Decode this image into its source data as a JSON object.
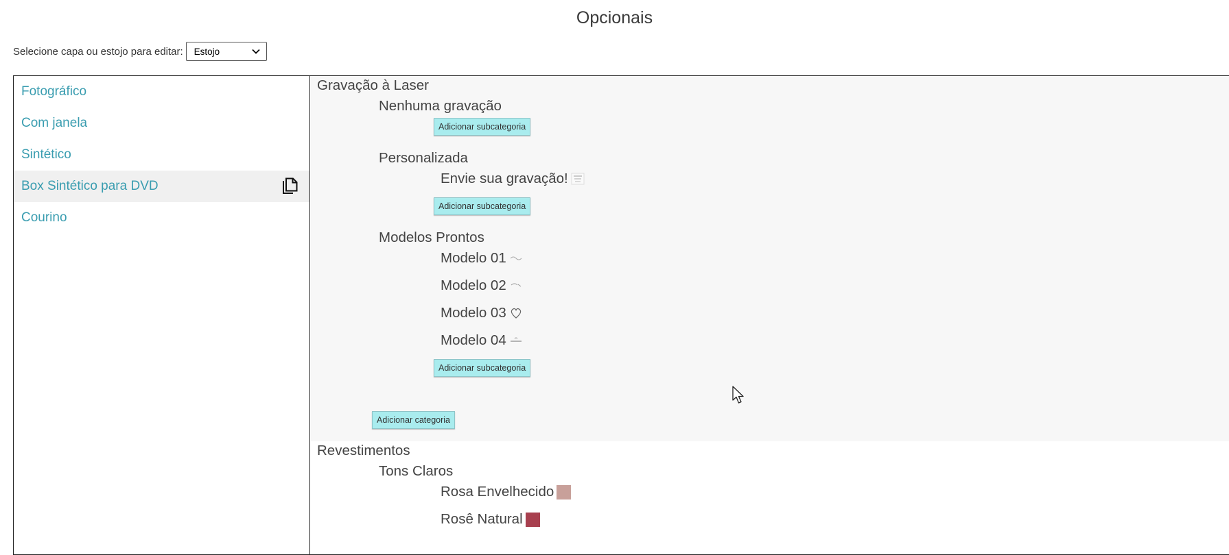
{
  "page": {
    "title": "Opcionais"
  },
  "selector": {
    "label": "Selecione capa ou estojo para editar:",
    "value": "Estojo"
  },
  "sidebar": {
    "items": [
      {
        "label": "Fotográfico"
      },
      {
        "label": "Com janela"
      },
      {
        "label": "Sintético"
      },
      {
        "label": "Box Sintético para DVD",
        "active": true,
        "icon": "copy-icon"
      },
      {
        "label": "Courino"
      }
    ]
  },
  "sections": {
    "laser": {
      "title": "Gravação à Laser",
      "groups": [
        {
          "title": "Nenhuma gravação",
          "items": []
        },
        {
          "title": "Personalizada",
          "items": [
            {
              "label": "Envie sua gravação!",
              "icon": "engraving-thumbnail"
            }
          ]
        },
        {
          "title": "Modelos Prontos",
          "items": [
            {
              "label": "Modelo 01",
              "icon": "model-thumbnail"
            },
            {
              "label": "Modelo 02",
              "icon": "model-thumbnail"
            },
            {
              "label": "Modelo 03",
              "icon": "heart-thumbnail"
            },
            {
              "label": "Modelo 04",
              "icon": "model-thumbnail"
            }
          ]
        }
      ],
      "add_subcategory_label": "Adicionar subcategoria",
      "add_category_label": "Adicionar categoria"
    },
    "coatings": {
      "title": "Revestimentos",
      "groups": [
        {
          "title": "Tons Claros",
          "items": [
            {
              "label": "Rosa Envelhecido",
              "color": "#c8a09a"
            },
            {
              "label": "Rosê Natural",
              "color": "#a8404f"
            }
          ]
        }
      ]
    }
  },
  "colors": {
    "link": "#3a9db0",
    "button": "#a9ecee",
    "panel_bg": "#f7f7f7"
  }
}
